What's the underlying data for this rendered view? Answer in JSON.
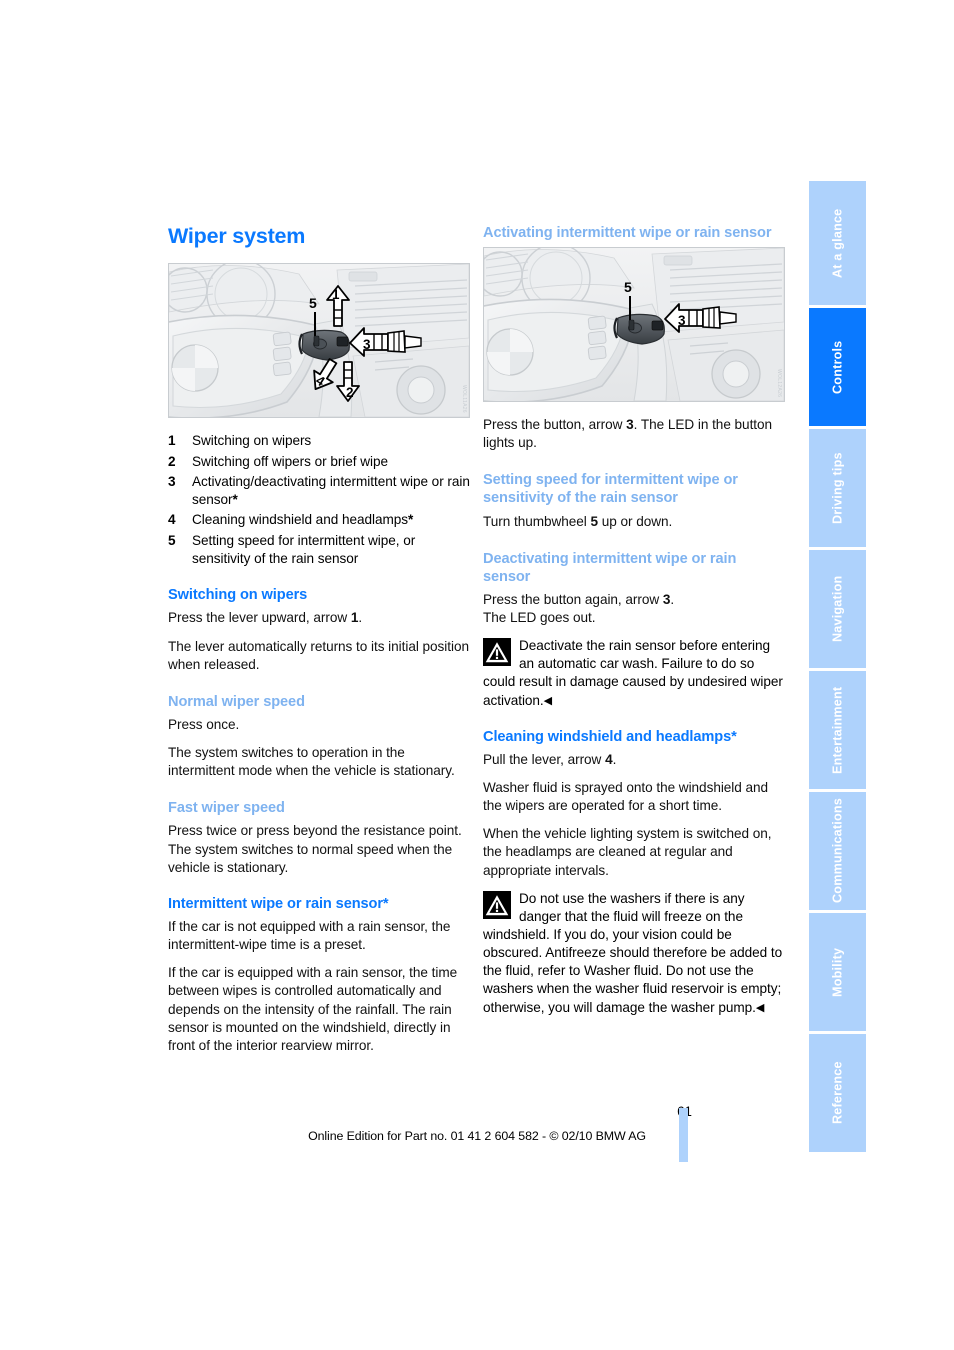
{
  "document": {
    "title": "Wiper system",
    "page_number": "61",
    "footer_text": "Online Edition for Part no. 01 41 2 604 582 - © 02/10 BMW AG"
  },
  "sidebar": {
    "tabs": [
      {
        "label": "At a glance",
        "active": false
      },
      {
        "label": "Controls",
        "active": true
      },
      {
        "label": "Driving tips",
        "active": false
      },
      {
        "label": "Navigation",
        "active": false
      },
      {
        "label": "Entertainment",
        "active": false
      },
      {
        "label": "Communications",
        "active": false
      },
      {
        "label": "Mobility",
        "active": false
      },
      {
        "label": "Reference",
        "active": false
      }
    ]
  },
  "colors": {
    "heading_primary": "#0a79ff",
    "heading_secondary": "#7fb3f0",
    "tab_inactive_bg": "#aed2fc",
    "tab_active_bg": "#0a79ff"
  },
  "left_column": {
    "figure": {
      "caption_id": "wiper-stalk-controls-diagram",
      "callouts": [
        "1",
        "2",
        "3",
        "4",
        "5"
      ]
    },
    "legend": [
      {
        "num": "1",
        "text": "Switching on wipers",
        "star": false
      },
      {
        "num": "2",
        "text": "Switching off wipers or brief wipe",
        "star": false
      },
      {
        "num": "3",
        "text": "Activating/deactivating intermittent wipe or rain sensor",
        "star": true
      },
      {
        "num": "4",
        "text": "Cleaning windshield and headlamps",
        "star": true
      },
      {
        "num": "5",
        "text": "Setting speed for intermittent wipe, or sensitivity of the rain sensor",
        "star": false
      }
    ],
    "sections": [
      {
        "heading": "Switching on wipers",
        "level": "h2",
        "paragraphs": [
          "Press the lever upward, arrow 1.",
          "The lever automatically returns to its initial position when released."
        ]
      },
      {
        "heading": "Normal wiper speed",
        "level": "h3",
        "paragraphs": [
          "Press once.",
          "The system switches to operation in the intermittent mode when the vehicle is stationary."
        ]
      },
      {
        "heading": "Fast wiper speed",
        "level": "h3",
        "paragraphs": [
          "Press twice or press beyond the resistance point.",
          "The system switches to normal speed when the vehicle is stationary."
        ]
      },
      {
        "heading": "Intermittent wipe or rain sensor*",
        "level": "h2",
        "paragraphs": [
          "If the car is not equipped with a rain sensor, the intermittent-wipe time is a preset.",
          "If the car is equipped with a rain sensor, the time between wipes is controlled automatically and depends on the intensity of the rainfall. The rain sensor is mounted on the windshield, directly in front of the interior rearview mirror."
        ]
      }
    ]
  },
  "right_column": {
    "top_heading": "Activating intermittent wipe or rain sensor",
    "figure": {
      "caption_id": "wiper-stalk-button-diagram",
      "callouts": [
        "3",
        "5"
      ]
    },
    "intro_paragraph": "Press the button, arrow 3. The LED in the button lights up.",
    "sections": [
      {
        "heading": "Setting speed for intermittent wipe or sensitivity of the rain sensor",
        "level": "h3",
        "paragraphs": [
          "Turn thumbwheel 5 up or down."
        ]
      },
      {
        "heading": "Deactivating intermittent wipe or rain sensor",
        "level": "h3",
        "paragraphs": [
          "Press the button again, arrow 3.",
          "The LED goes out."
        ]
      }
    ],
    "warning_1": "Deactivate the rain sensor before entering an automatic car wash. Failure to do so could result in damage caused by undesired wiper activation.",
    "cleaning": {
      "heading": "Cleaning windshield and headlamps*",
      "paragraphs": [
        "Pull the lever, arrow 4.",
        "Washer fluid is sprayed onto the windshield and the wipers are operated for a short time.",
        "When the vehicle lighting system is switched on, the headlamps are cleaned at regular and appropriate intervals."
      ]
    },
    "warning_2": "Do not use the washers if there is any danger that the fluid will freeze on the windshield. If you do, your vision could be obscured. Antifreeze should therefore be added to the fluid, refer to Washer fluid. Do not use the washers when the washer fluid reservoir is empty; otherwise, you will damage the washer pump."
  }
}
